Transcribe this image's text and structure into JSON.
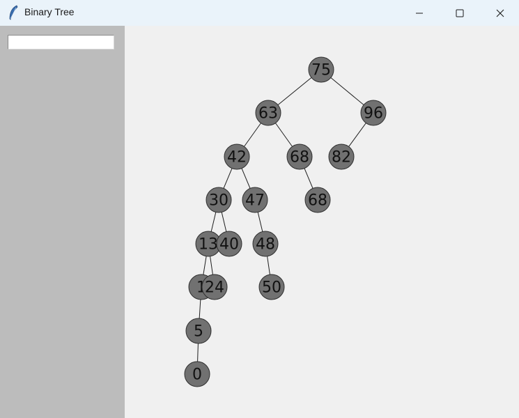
{
  "window": {
    "title": "Binary Tree",
    "app_icon": "feather-icon",
    "controls": [
      "minimize-icon",
      "maximize-icon",
      "close-icon"
    ]
  },
  "sidebar": {
    "input_value": ""
  },
  "tree": {
    "nodes": [
      {
        "id": "n75",
        "value": "75"
      },
      {
        "id": "n63",
        "value": "63"
      },
      {
        "id": "n96",
        "value": "96"
      },
      {
        "id": "n42",
        "value": "42"
      },
      {
        "id": "n68a",
        "value": "68"
      },
      {
        "id": "n82",
        "value": "82"
      },
      {
        "id": "n30",
        "value": "30"
      },
      {
        "id": "n47",
        "value": "47"
      },
      {
        "id": "n68b",
        "value": "68"
      },
      {
        "id": "n13",
        "value": "13"
      },
      {
        "id": "n40",
        "value": "40"
      },
      {
        "id": "n48",
        "value": "48"
      },
      {
        "id": "n1x",
        "value": "1"
      },
      {
        "id": "n24",
        "value": "24"
      },
      {
        "id": "n50",
        "value": "50"
      },
      {
        "id": "n5",
        "value": "5"
      },
      {
        "id": "n0",
        "value": "0"
      }
    ],
    "edges": [
      [
        "n75",
        "n63"
      ],
      [
        "n75",
        "n96"
      ],
      [
        "n63",
        "n42"
      ],
      [
        "n63",
        "n68a"
      ],
      [
        "n96",
        "n82"
      ],
      [
        "n42",
        "n30"
      ],
      [
        "n42",
        "n47"
      ],
      [
        "n68a",
        "n68b"
      ],
      [
        "n30",
        "n13"
      ],
      [
        "n30",
        "n40"
      ],
      [
        "n47",
        "n48"
      ],
      [
        "n13",
        "n1x"
      ],
      [
        "n13",
        "n24"
      ],
      [
        "n48",
        "n50"
      ],
      [
        "n1x",
        "n5"
      ],
      [
        "n5",
        "n0"
      ]
    ]
  }
}
